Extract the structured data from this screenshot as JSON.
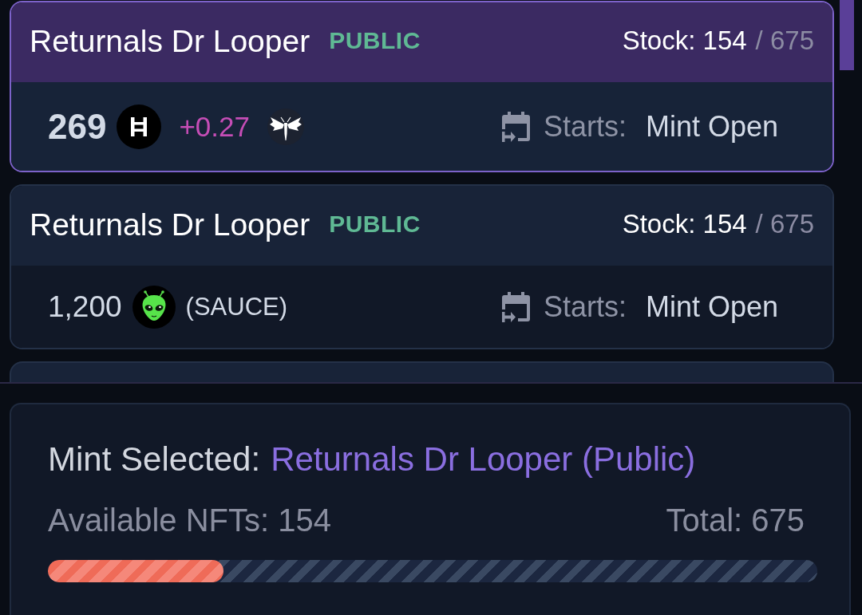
{
  "list": {
    "cards": [
      {
        "title": "Returnals Dr Looper",
        "phase": "PUBLIC",
        "stock": "Stock: 154",
        "stock_total": "/ 675",
        "selected": true,
        "price": [
          {
            "kind": "amount",
            "text": "269"
          },
          {
            "kind": "hbar"
          },
          {
            "kind": "fee",
            "text": "+0.27"
          },
          {
            "kind": "moth"
          }
        ],
        "start_label": "Starts:",
        "start_value": "Mint Open"
      },
      {
        "title": "Returnals Dr Looper",
        "phase": "PUBLIC",
        "stock": "Stock: 154",
        "stock_total": "/ 675",
        "selected": false,
        "price": [
          {
            "kind": "amount",
            "text": "1,200"
          },
          {
            "kind": "alien"
          },
          {
            "kind": "ticker",
            "text": "(SAUCE)"
          }
        ],
        "start_label": "Starts:",
        "start_value": "Mint Open"
      }
    ]
  },
  "summary": {
    "label": "Mint Selected:",
    "selection": "Returnals Dr Looper (Public)",
    "available": "Available NFTs: 154",
    "total": "Total: 675",
    "level": 0.228
  }
}
